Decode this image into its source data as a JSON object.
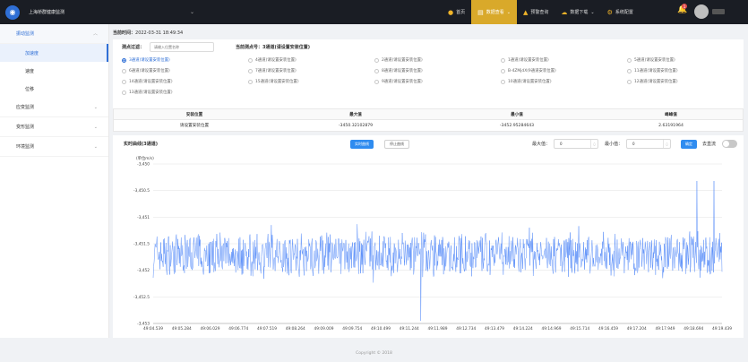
{
  "header": {
    "logo_glyph": "◉",
    "app_title": "上海桥群健康监测",
    "collapse_glyph": "⌄",
    "nav": [
      {
        "label": "首页",
        "icon": "home-icon",
        "glyph": "●",
        "active": false
      },
      {
        "label": "数据查看",
        "icon": "data-icon",
        "glyph": "▤",
        "active": true,
        "chevron": "⌄"
      },
      {
        "label": "预警查询",
        "icon": "warning-icon",
        "glyph": "▲",
        "active": false
      },
      {
        "label": "数据下载",
        "icon": "download-icon",
        "glyph": "☁",
        "active": false,
        "chevron": "⌄"
      },
      {
        "label": "系统配置",
        "icon": "settings-icon",
        "glyph": "⚙",
        "active": false
      }
    ],
    "bell_glyph": "🔔",
    "notification_count": "1"
  },
  "sidebar": {
    "groups": [
      {
        "label": "振动监测",
        "open": true,
        "items": [
          {
            "label": "加速度",
            "active": true
          },
          {
            "label": "速度",
            "active": false
          },
          {
            "label": "位移",
            "active": false
          }
        ]
      },
      {
        "label": "应变监测",
        "open": false,
        "items": []
      },
      {
        "label": "变形监测",
        "open": false,
        "items": []
      },
      {
        "label": "环境监测",
        "open": false,
        "items": []
      }
    ],
    "chevron_glyph": "⌄"
  },
  "main": {
    "current_time_label": "当前时间：",
    "current_time_value": "2022-03-31 18:49:34",
    "filter_label": "测点过滤：",
    "filter_placeholder": "请输入位置名称",
    "current_point_label": "当前测点号：",
    "current_point_value": "3通道(请设置安装位置)",
    "points": [
      {
        "label": "3通道(请设置安装位置)",
        "checked": true
      },
      {
        "label": "4通道(请设置安装位置)",
        "checked": false
      },
      {
        "label": "2通道(请设置安装位置)",
        "checked": false
      },
      {
        "label": "1通道(请设置安装位置)",
        "checked": false
      },
      {
        "label": "5通道(请设置安装位置)",
        "checked": false
      },
      {
        "label": "6通道(请设置安装位置)",
        "checked": false
      },
      {
        "label": "7通道(请设置安装位置)",
        "checked": false
      },
      {
        "label": "8通道(请设置安装位置)",
        "checked": false
      },
      {
        "label": "B-4ZMjdX(9通道安装位置)",
        "checked": false
      },
      {
        "label": "11通道(请设置安装位置)",
        "checked": false
      },
      {
        "label": "14通道(请设置安装位置)",
        "checked": false
      },
      {
        "label": "15通道(请设置安装位置)",
        "checked": false
      },
      {
        "label": "9通道(请设置安装位置)",
        "checked": false
      },
      {
        "label": "10通道(请设置安装位置)",
        "checked": false
      },
      {
        "label": "12通道(请设置安装位置)",
        "checked": false
      },
      {
        "label": "13通道(请设置安装位置)",
        "checked": false
      }
    ],
    "stats_table": {
      "headers": [
        "安装位置",
        "最大值",
        "最小值",
        "峰峰值"
      ],
      "row": [
        "请设置安装位置",
        "-3450.32102879",
        "-3452.95284643",
        "2.63191964"
      ]
    },
    "chart_controls": {
      "title": "实时曲线(3通道)",
      "realtime_button": "实时曲线",
      "history_button": "停止曲线",
      "max_label": "最大值：",
      "max_value": "0",
      "min_label": "最小值：",
      "min_value": "0",
      "confirm_button": "确定",
      "dedup_label": "去直流",
      "dedup_enabled": false,
      "spinner_up": "︿",
      "spinner_down": "﹀"
    }
  },
  "chart_data": {
    "type": "line",
    "ylabel": "(单位m/s)",
    "ylim": [
      -3453,
      -3450
    ],
    "yticks": [
      -3450,
      -3450.5,
      -3451,
      -3451.5,
      -3452,
      -3452.5,
      -3453
    ],
    "ytick_labels": [
      "-3,450",
      "-3,450.5",
      "-3,451",
      "-3,451.5",
      "-3,452",
      "-3,452.5",
      "-3,453"
    ],
    "xtick_labels": [
      "49:04.539",
      "49:05.284",
      "49:06.029",
      "49:06.774",
      "49:07.519",
      "49:08.264",
      "49:09.009",
      "49:09.754",
      "49:10.499",
      "49:11.244",
      "49:11.989",
      "49:12.734",
      "49:13.479",
      "49:14.224",
      "49:14.969",
      "49:15.714",
      "49:16.459",
      "49:17.204",
      "49:17.949",
      "49:18.694",
      "49:19.439"
    ],
    "series": [
      {
        "color": "#5b8ff9",
        "mean": -3451.7,
        "band": 0.38,
        "min": -3452.95,
        "max": -3450.32,
        "samples": 1200
      }
    ],
    "grid": true
  },
  "footer": {
    "copyright": "Copyright © 2018"
  }
}
